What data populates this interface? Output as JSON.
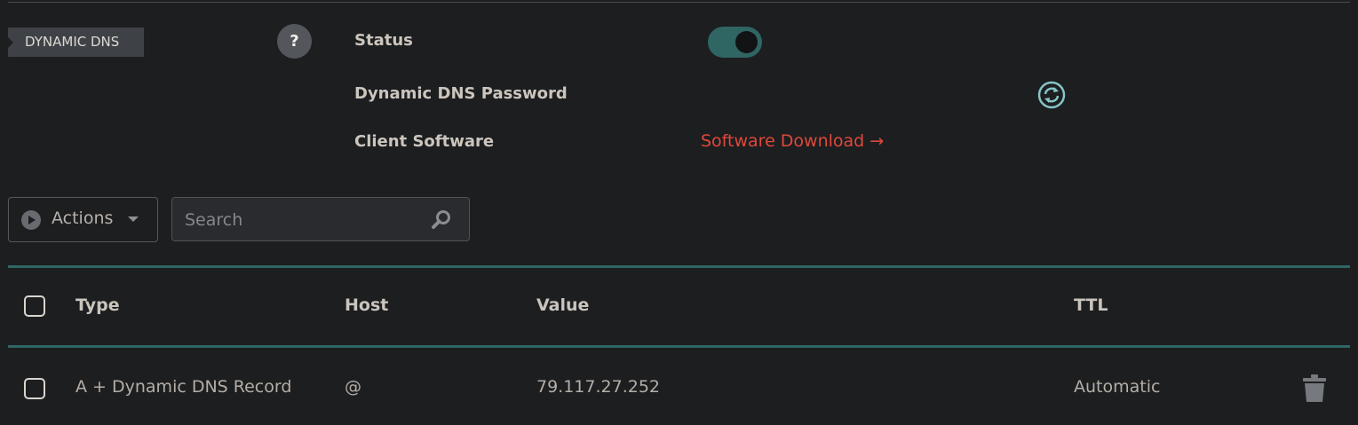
{
  "section": {
    "title": "DYNAMIC DNS",
    "help_label": "?"
  },
  "settings": {
    "status_label": "Status",
    "status_enabled": true,
    "password_label": "Dynamic DNS Password",
    "client_label": "Client Software",
    "download_link": "Software Download →"
  },
  "toolbar": {
    "actions_label": "Actions",
    "search_placeholder": "Search",
    "search_value": ""
  },
  "table": {
    "headers": {
      "type": "Type",
      "host": "Host",
      "value": "Value",
      "ttl": "TTL"
    },
    "rows": [
      {
        "type": "A + Dynamic DNS Record",
        "host": "@",
        "value": "79.117.27.252",
        "ttl": "Automatic"
      }
    ]
  },
  "colors": {
    "accent_teal": "#2f6664",
    "link_red": "#e0483a",
    "regen_icon": "#86c4c6",
    "background": "#1d1e20"
  },
  "icons": [
    "help-icon",
    "refresh-icon",
    "play-icon",
    "chevron-down-icon",
    "search-icon",
    "trash-icon"
  ]
}
